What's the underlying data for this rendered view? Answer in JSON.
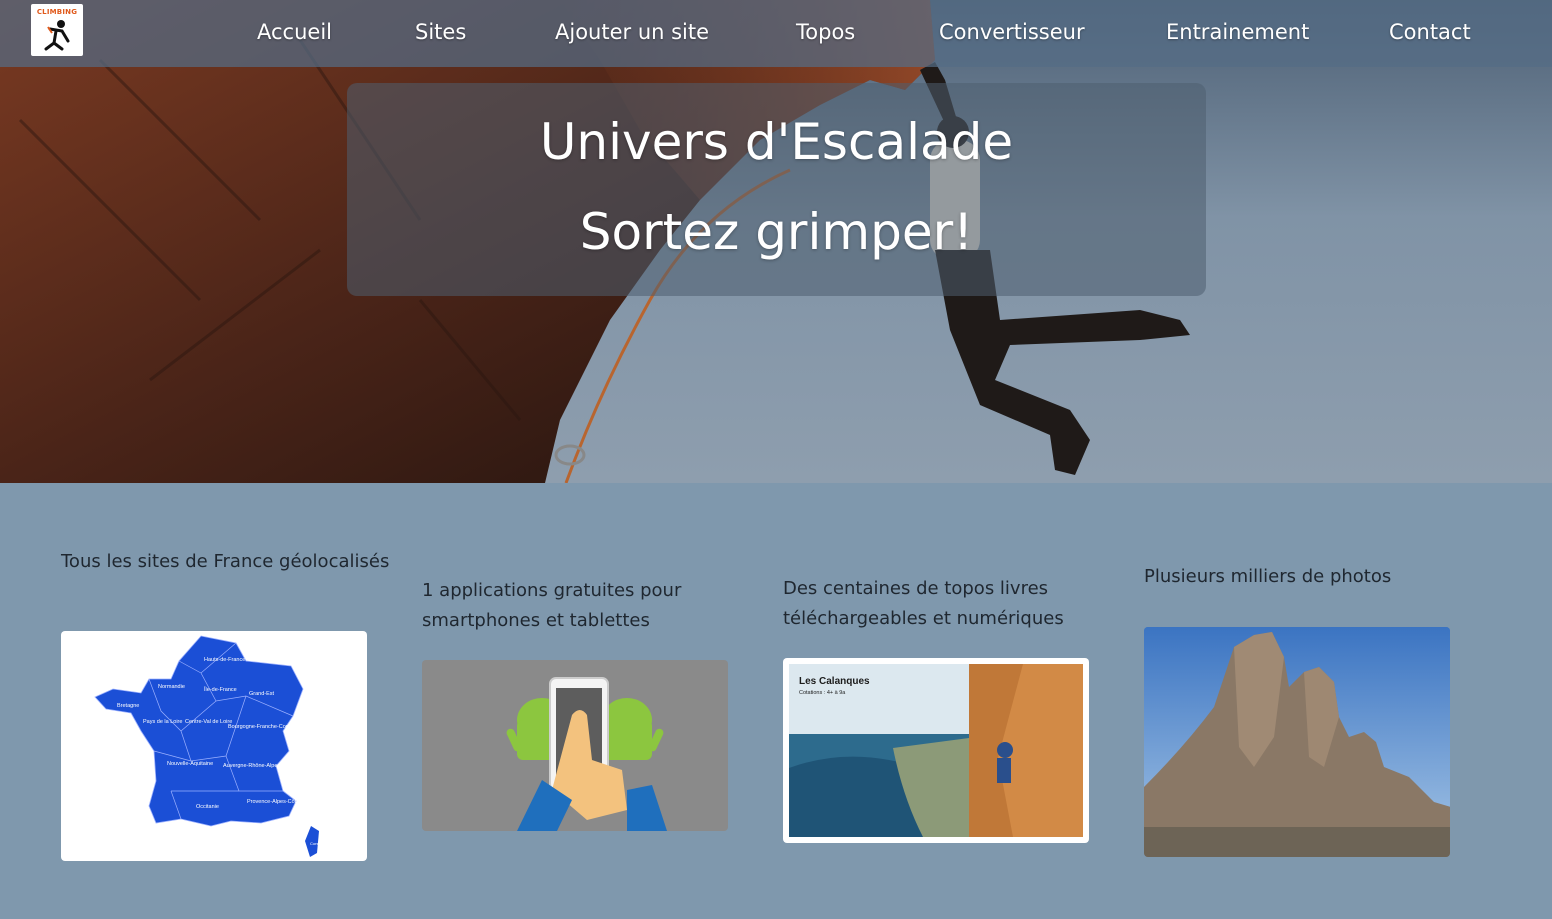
{
  "logo": {
    "text": "CLIMBING",
    "icon": "climber-icon"
  },
  "nav": {
    "items": [
      {
        "label": "Accueil"
      },
      {
        "label": "Sites"
      },
      {
        "label": "Ajouter un site"
      },
      {
        "label": "Topos"
      },
      {
        "label": "Convertisseur"
      },
      {
        "label": "Entrainement"
      },
      {
        "label": "Contact"
      }
    ]
  },
  "hero": {
    "title": "Univers d'Escalade",
    "subtitle": "Sortez grimper!"
  },
  "features": [
    {
      "caption": "Tous les sites de France géolocalisés",
      "map_labels": [
        "Hauts-de-France",
        "Normandie",
        "Île-de-France",
        "Grand-Est",
        "Bretagne",
        "Pays de la Loire",
        "Centre-Val de Loire",
        "Bourgogne-Franche-Comté",
        "Nouvelle-Aquitaine",
        "Auvergne-Rhône-Alpes",
        "Occitanie",
        "Provence-Alpes-Côte d'Azur",
        "Corse"
      ]
    },
    {
      "caption": "1 applications gratuites pour smartphones et tablettes"
    },
    {
      "caption": "Des centaines de topos livres téléchargeables et numériques",
      "topo_title": "Les Calanques",
      "topo_sub": "Cotations : 4+ à 9a"
    },
    {
      "caption": "Plusieurs milliers de photos"
    }
  ],
  "colors": {
    "page_bg": "#7f98ad",
    "map_blue": "#1b4fd6",
    "nav_text": "#ffffff"
  }
}
